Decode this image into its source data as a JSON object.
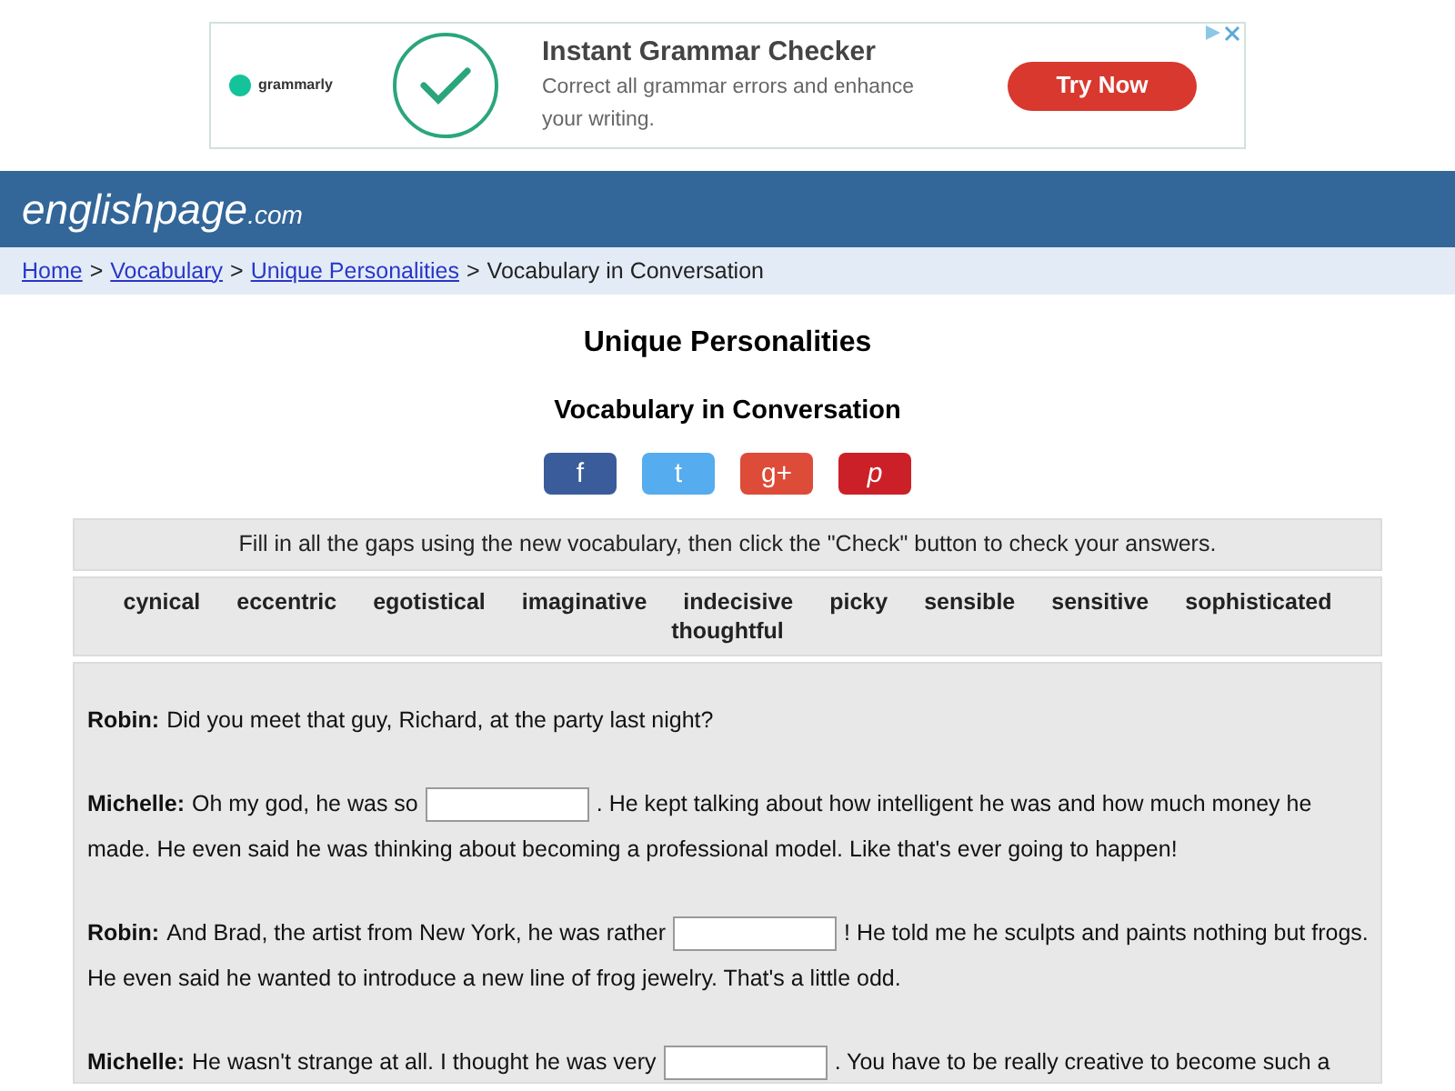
{
  "ad": {
    "brand": "grammarly",
    "title": "Instant Grammar Checker",
    "text": "Correct all grammar errors and enhance your writing.",
    "button": "Try Now"
  },
  "header": {
    "site": "englishpage",
    "suffix": ".com"
  },
  "breadcrumb": {
    "links": [
      "Home",
      "Vocabulary",
      "Unique Personalities"
    ],
    "separator": ">",
    "current": "Vocabulary in Conversation"
  },
  "title": "Unique Personalities",
  "subtitle": "Vocabulary in Conversation",
  "share": [
    {
      "kind": "facebook",
      "label": "f"
    },
    {
      "kind": "twitter",
      "label": "t"
    },
    {
      "kind": "googleplus",
      "label": "g+"
    },
    {
      "kind": "pinterest",
      "label": "p"
    }
  ],
  "instructions": "Fill in all the gaps using the new vocabulary, then click the \"Check\" button to check your answers.",
  "word_bank": [
    "cynical",
    "eccentric",
    "egotistical",
    "imaginative",
    "indecisive",
    "picky",
    "sensible",
    "sensitive",
    "sophisticated",
    "thoughtful"
  ],
  "dialogue": [
    {
      "speaker": "Robin:",
      "lines": [
        [
          {
            "kind": "text",
            "text": "Did you meet that guy, Richard, at the party last night?"
          }
        ]
      ]
    },
    {
      "speaker": "Michelle:",
      "lines": [
        [
          {
            "kind": "text",
            "text": "Oh my god, he was so"
          },
          {
            "kind": "gap"
          },
          {
            "kind": "text",
            "text": ". He kept talking about how intelligent he was and how much money he"
          }
        ],
        [
          {
            "kind": "text",
            "text": "made. He even said he was thinking about becoming a professional model. Like that's ever going to happen!"
          }
        ]
      ]
    },
    {
      "speaker": "Robin:",
      "lines": [
        [
          {
            "kind": "text",
            "text": "And Brad, the artist from New York, he was rather"
          },
          {
            "kind": "gap"
          },
          {
            "kind": "text",
            "text": "! He told me he sculpts and paints nothing but frogs."
          }
        ],
        [
          {
            "kind": "text",
            "text": "He even said he wanted to introduce a new line of frog jewelry. That's a little odd."
          }
        ]
      ]
    },
    {
      "speaker": "Michelle:",
      "lines": [
        [
          {
            "kind": "text",
            "text": "He wasn't strange at all. I thought he was very"
          },
          {
            "kind": "gap"
          },
          {
            "kind": "text",
            "text": ". You have to be really creative to become such a"
          }
        ]
      ]
    }
  ]
}
